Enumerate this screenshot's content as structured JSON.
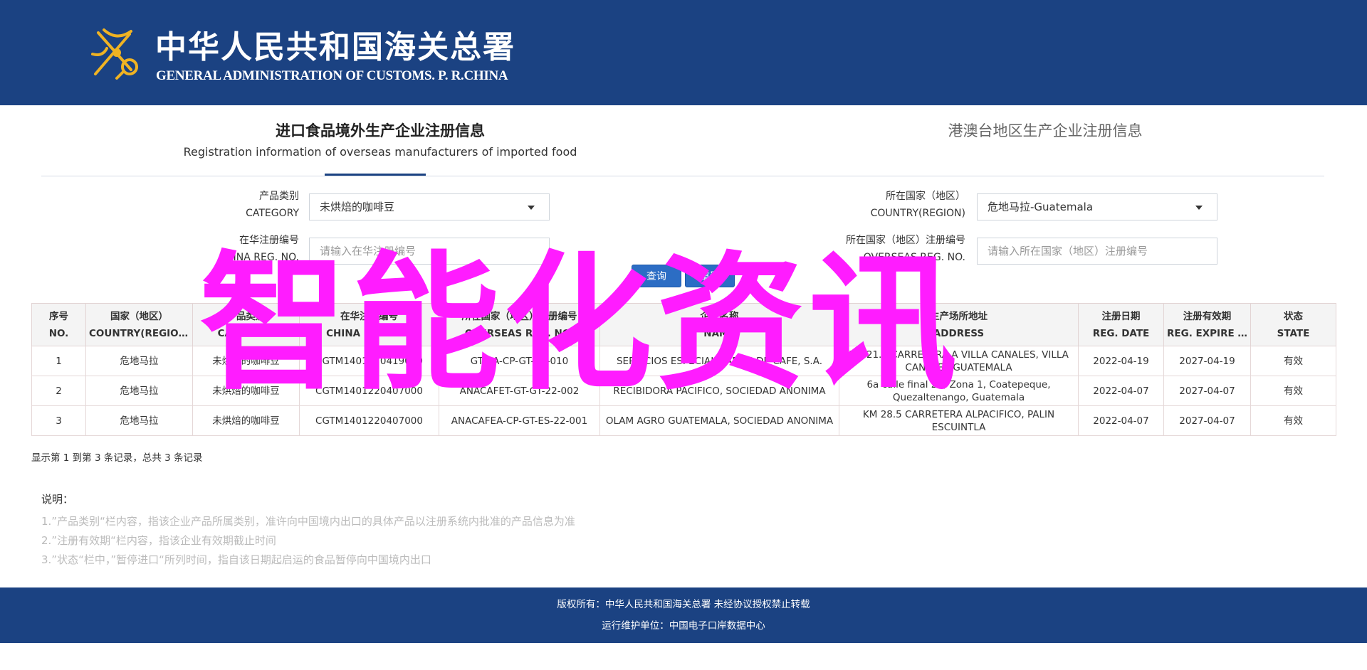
{
  "header": {
    "title_cn": "中华人民共和国海关总署",
    "title_en": "GENERAL ADMINISTRATION OF CUSTOMS. P. R.CHINA",
    "emblem_icon": "customs-emblem-icon"
  },
  "tabs": {
    "active_title": "进口食品境外生产企业注册信息",
    "active_subtitle": "Registration information of overseas manufacturers of imported food",
    "other_title": "港澳台地区生产企业注册信息"
  },
  "filters": {
    "category": {
      "label_cn": "产品类别",
      "label_en": "CATEGORY",
      "value": "未烘焙的咖啡豆"
    },
    "country": {
      "label_cn": "所在国家（地区）",
      "label_en": "COUNTRY(REGION)",
      "value": "危地马拉-Guatemala"
    },
    "china_reg": {
      "label_cn": "在华注册编号",
      "label_en": "CHINA REG. NO.",
      "placeholder": "请输入在华注册编号"
    },
    "overseas_reg": {
      "label_cn": "所在国家（地区）注册编号",
      "label_en": "OVERSEAS REG. NO.",
      "placeholder": "请输入所在国家（地区）注册编号"
    }
  },
  "buttons": {
    "query": "查询",
    "reset": "重置"
  },
  "table": {
    "headers": [
      {
        "cn": "序号",
        "en": "NO."
      },
      {
        "cn": "国家（地区）",
        "en": "COUNTRY(REGION)"
      },
      {
        "cn": "产品类别",
        "en": "CATEGORY"
      },
      {
        "cn": "在华注册编号",
        "en": "CHINA REG. NO."
      },
      {
        "cn": "所在国家（地区）注册编号",
        "en": "OVERSEAS REG. NO."
      },
      {
        "cn": "企业名称",
        "en": "NAME"
      },
      {
        "cn": "生产场所地址",
        "en": "ADDRESS"
      },
      {
        "cn": "注册日期",
        "en": "REG. DATE"
      },
      {
        "cn": "注册有效期",
        "en": "REG. EXPIRE D..."
      },
      {
        "cn": "状态",
        "en": "STATE"
      }
    ],
    "rows": [
      [
        "1",
        "危地马拉",
        "未烘焙的咖啡豆",
        "CGTM1401220419000",
        "GT/EA-CP-GT-22-010",
        "SERVICIOS ESPECIALIZADOS DE CAFE, S.A.",
        "KM 21.5 CARRETERA A VILLA CANALES, VILLA CANALES GUATEMALA",
        "2022-04-19",
        "2027-04-19",
        "有效"
      ],
      [
        "2",
        "危地马拉",
        "未烘焙的咖啡豆",
        "CGTM1401220407000",
        "ANACAFET-GT-GT-22-002",
        "RECIBIDORA PACIFICO, SOCIEDAD ANONIMA",
        "6a calle final 25, Zona 1, Coatepeque, Quezaltenango, Guatemala",
        "2022-04-07",
        "2027-04-07",
        "有效"
      ],
      [
        "3",
        "危地马拉",
        "未烘焙的咖啡豆",
        "CGTM1401220407000",
        "ANACAFEA-CP-GT-ES-22-001",
        "OLAM AGRO GUATEMALA, SOCIEDAD ANONIMA",
        "KM 28.5 CARRETERA ALPACIFICO, PALIN ESCUINTLA",
        "2022-04-07",
        "2027-04-07",
        "有效"
      ]
    ]
  },
  "pager_text": "显示第 1 到第 3 条记录，总共 3 条记录",
  "notes": {
    "title": "说明：",
    "items": [
      "1.”产品类别“栏内容，指该企业产品所属类别，准许向中国境内出口的具体产品以注册系统内批准的产品信息为准",
      "2.”注册有效期“栏内容，指该企业有效期截止时间",
      "3.”状态“栏中，”暂停进口“所列时间，指自该日期起启运的食品暂停向中国境内出口"
    ]
  },
  "footer": {
    "line1": "版权所有：中华人民共和国海关总署 未经协议授权禁止转载",
    "line2": "运行维护单位：中国电子口岸数据中心"
  },
  "watermark": "智能化资讯",
  "colors": {
    "brand": "#1b4282",
    "button": "#2c6dc4",
    "watermark": "#ff1cff"
  }
}
